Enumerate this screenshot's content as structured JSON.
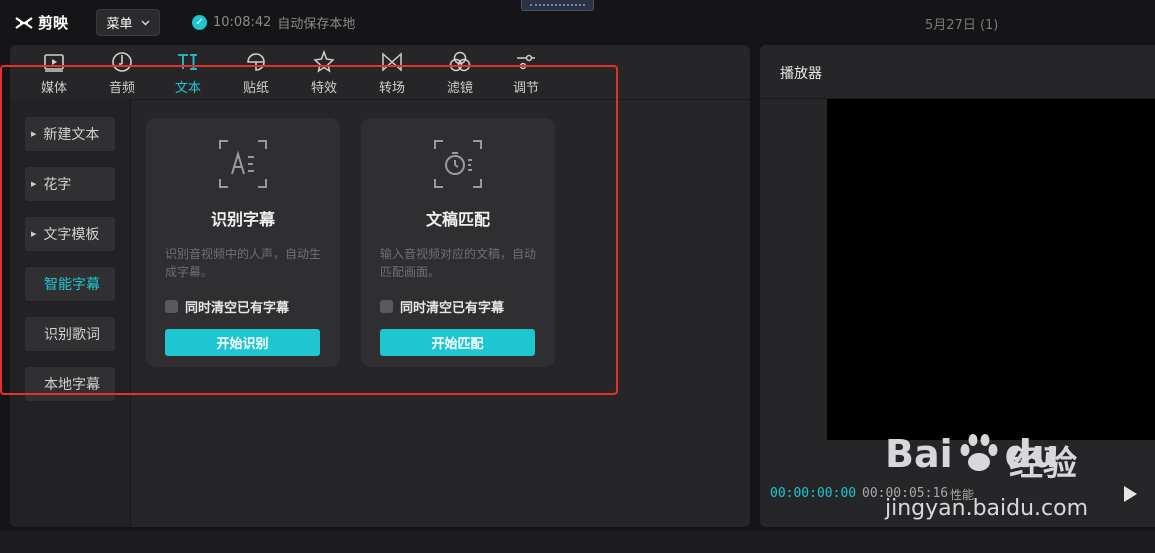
{
  "app": {
    "name": "剪映",
    "menu_label": "菜单",
    "save_time": "10:08:42",
    "save_text": "自动保存本地",
    "project_date": "5月27日 (1)"
  },
  "tabs": [
    {
      "label": "媒体",
      "icon": "media-icon"
    },
    {
      "label": "音频",
      "icon": "audio-icon"
    },
    {
      "label": "文本",
      "icon": "text-icon"
    },
    {
      "label": "贴纸",
      "icon": "sticker-icon"
    },
    {
      "label": "特效",
      "icon": "effects-icon"
    },
    {
      "label": "转场",
      "icon": "transition-icon"
    },
    {
      "label": "滤镜",
      "icon": "filter-icon"
    },
    {
      "label": "调节",
      "icon": "adjust-icon"
    }
  ],
  "active_tab": "文本",
  "sidebar": {
    "items": [
      {
        "label": "新建文本"
      },
      {
        "label": "花字"
      },
      {
        "label": "文字模板"
      },
      {
        "label": "智能字幕"
      },
      {
        "label": "识别歌词"
      },
      {
        "label": "本地字幕"
      }
    ],
    "active": "智能字幕"
  },
  "cards": [
    {
      "title": "识别字幕",
      "desc": "识别音视频中的人声，自动生成字幕。",
      "checkbox_label": "同时清空已有字幕",
      "button": "开始识别"
    },
    {
      "title": "文稿匹配",
      "desc": "输入音视频对应的文稿，自动匹配画面。",
      "checkbox_label": "同时清空已有字幕",
      "button": "开始匹配"
    }
  ],
  "player": {
    "title": "播放器",
    "current_time": "00:00:00:00",
    "total_time": "00:00:05:16",
    "perf_label": "性能"
  },
  "watermark": {
    "brand_left": "Bai",
    "brand_right": "du",
    "suffix": "经验",
    "url": "jingyan.baidu.com"
  },
  "colors": {
    "accent": "#1ec6d2",
    "highlight_frame": "#e8302a"
  }
}
